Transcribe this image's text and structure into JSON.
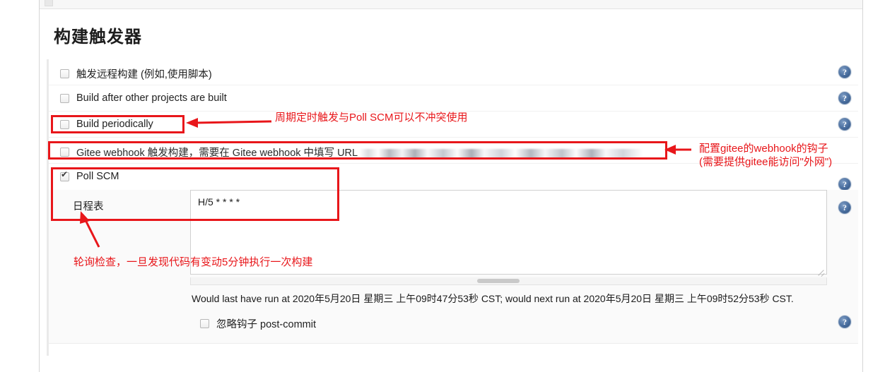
{
  "section": {
    "title": "构建触发器"
  },
  "triggers": [
    {
      "label": "触发远程构建 (例如,使用脚本)",
      "checked": false,
      "name": "trigger-remote-build"
    },
    {
      "label": "Build after other projects are built",
      "checked": false,
      "name": "build-after-other-projects"
    },
    {
      "label": "Build periodically",
      "checked": false,
      "name": "build-periodically"
    },
    {
      "label": "Gitee webhook 触发构建，需要在 Gitee webhook 中填写 URL",
      "checked": false,
      "name": "gitee-webhook-trigger",
      "redacted_value": true
    },
    {
      "label": "Poll SCM",
      "checked": true,
      "name": "poll-scm"
    }
  ],
  "poll_scm": {
    "schedule_label": "日程表",
    "schedule_value": "H/5 * * * *",
    "status_text": "Would last have run at 2020年5月20日 星期三 上午09时47分53秒 CST; would next run at 2020年5月20日 星期三 上午09时52分53秒 CST.",
    "ignore_post_commit_label": "忽略钩子 post-commit",
    "ignore_post_commit_checked": false
  },
  "help_icon_glyph": "?",
  "annotations": [
    {
      "id": "periodically",
      "text": "周期定时触发与Poll SCM可以不冲突使用"
    },
    {
      "id": "webhook-line1",
      "text": "配置gitee的webhook的钩子"
    },
    {
      "id": "webhook-line2",
      "text": "(需要提供gitee能访问\"外网\")"
    },
    {
      "id": "poll",
      "text": "轮询检查，一旦发现代码有变动5分钟执行一次构建"
    }
  ],
  "colors": {
    "annotation_red": "#e8161a",
    "help_blue": "#4a6fa0",
    "panel_bg": "#fafafa"
  }
}
